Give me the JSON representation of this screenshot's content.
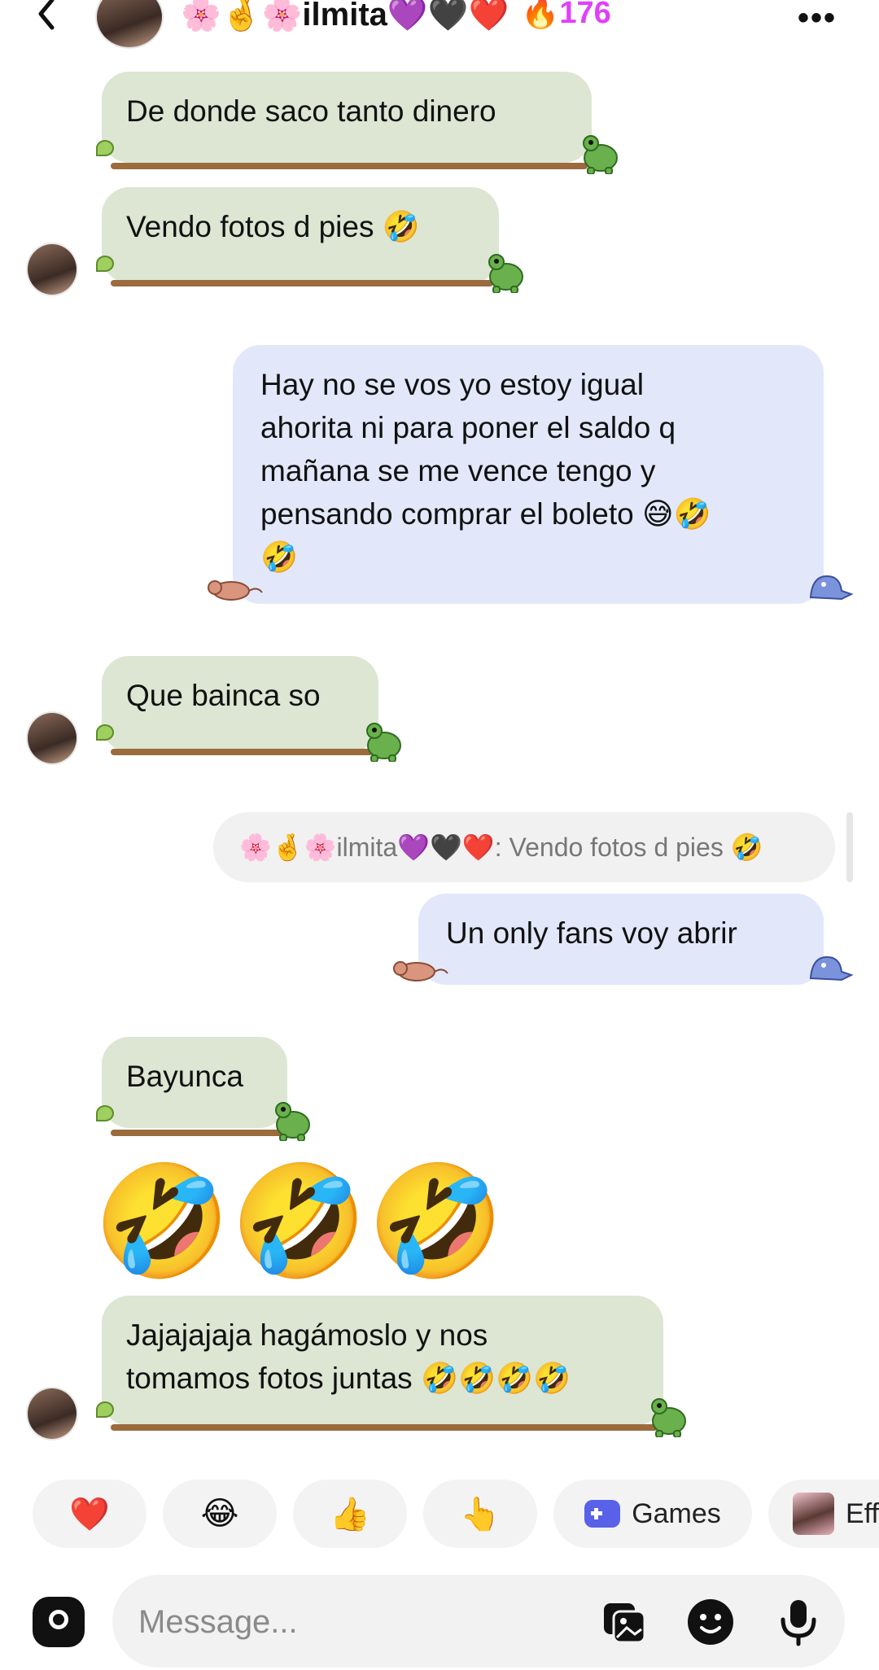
{
  "header": {
    "back_icon": "chevron-left-icon",
    "contact_name": "🌸🤞🌸ilmita💜🖤❤️",
    "streak": "🔥176",
    "more_icon": "more-dots-icon"
  },
  "messages": [
    {
      "from": "them",
      "text": "De donde saco tanto dinero"
    },
    {
      "from": "them",
      "text": "Vendo fotos d pies 🤣"
    },
    {
      "from": "me",
      "lines": [
        "Hay no se vos yo estoy igual",
        "ahorita ni para poner el saldo q",
        "mañana se me vence tengo y",
        "pensando comprar el boleto 😅🤣",
        "🤣"
      ]
    },
    {
      "from": "them",
      "text": "Que bainca so"
    },
    {
      "from": "me",
      "reply_quote": "🌸🤞🌸ilmita💜🖤❤️: Vendo fotos d pies 🤣",
      "text": "Un  only fans voy abrir"
    },
    {
      "from": "them",
      "text": "Bayunca"
    },
    {
      "from": "them",
      "text": "🤣🤣🤣"
    },
    {
      "from": "them",
      "lines": [
        "Jajajajaja hagámoslo y nos",
        "tomamos fotos juntas 🤣🤣🤣🤣"
      ]
    }
  ],
  "quick_reactions": [
    {
      "label": "❤️",
      "icon": "heart-icon"
    },
    {
      "label": "😂",
      "icon": "laughing-icon"
    },
    {
      "label": "👍",
      "icon": "thumbs-up-icon"
    },
    {
      "label": "👆",
      "icon": "pointing-up-icon"
    },
    {
      "label": "Games",
      "icon": "gamepad-icon"
    },
    {
      "label": "Eff",
      "icon": "effects-thumbnail-icon"
    }
  ],
  "composer": {
    "placeholder": "Message...",
    "camera_icon": "camera-icon",
    "gallery_icon": "gallery-icon",
    "sticker_icon": "sticker-icon",
    "mic_icon": "microphone-icon"
  },
  "colors": {
    "incoming_bubble": "#dce6d2",
    "outgoing_bubble": "#e2e8fa",
    "streak": "#e040fb",
    "games_accent": "#5861e8"
  }
}
